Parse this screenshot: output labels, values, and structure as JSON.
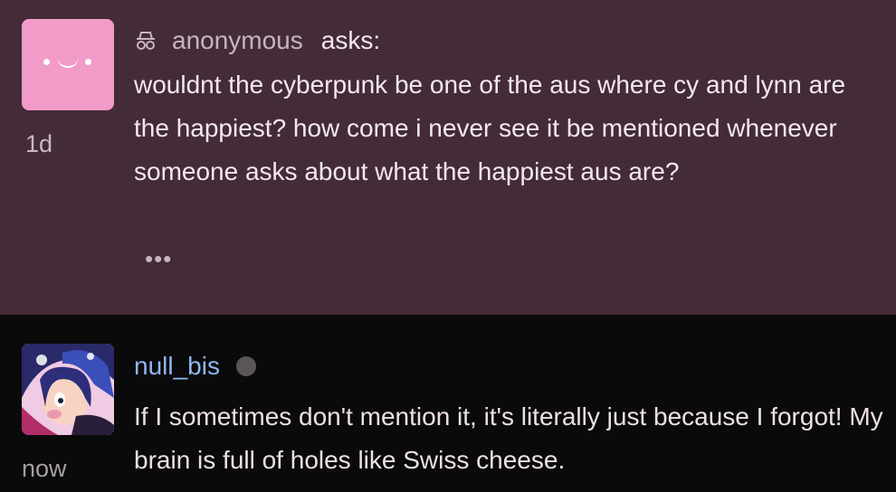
{
  "ask": {
    "sender": "anonymous",
    "verb": "asks:",
    "timestamp": "1d",
    "question": "wouldnt the cyberpunk be one of the aus where cy and lynn are the happiest? how come i never see it be mentioned whenever someone asks about what the happiest aus are?",
    "more_label": "•••"
  },
  "reply": {
    "username": "null_bis",
    "timestamp": "now",
    "text": "If I sometimes don't mention it, it's literally just because I forgot! My brain is full of holes like Swiss cheese."
  },
  "colors": {
    "ask_background": "#442b38",
    "reply_background": "#0b0a0b",
    "anon_avatar": "#f29bc9",
    "username": "#8fb8f2"
  }
}
